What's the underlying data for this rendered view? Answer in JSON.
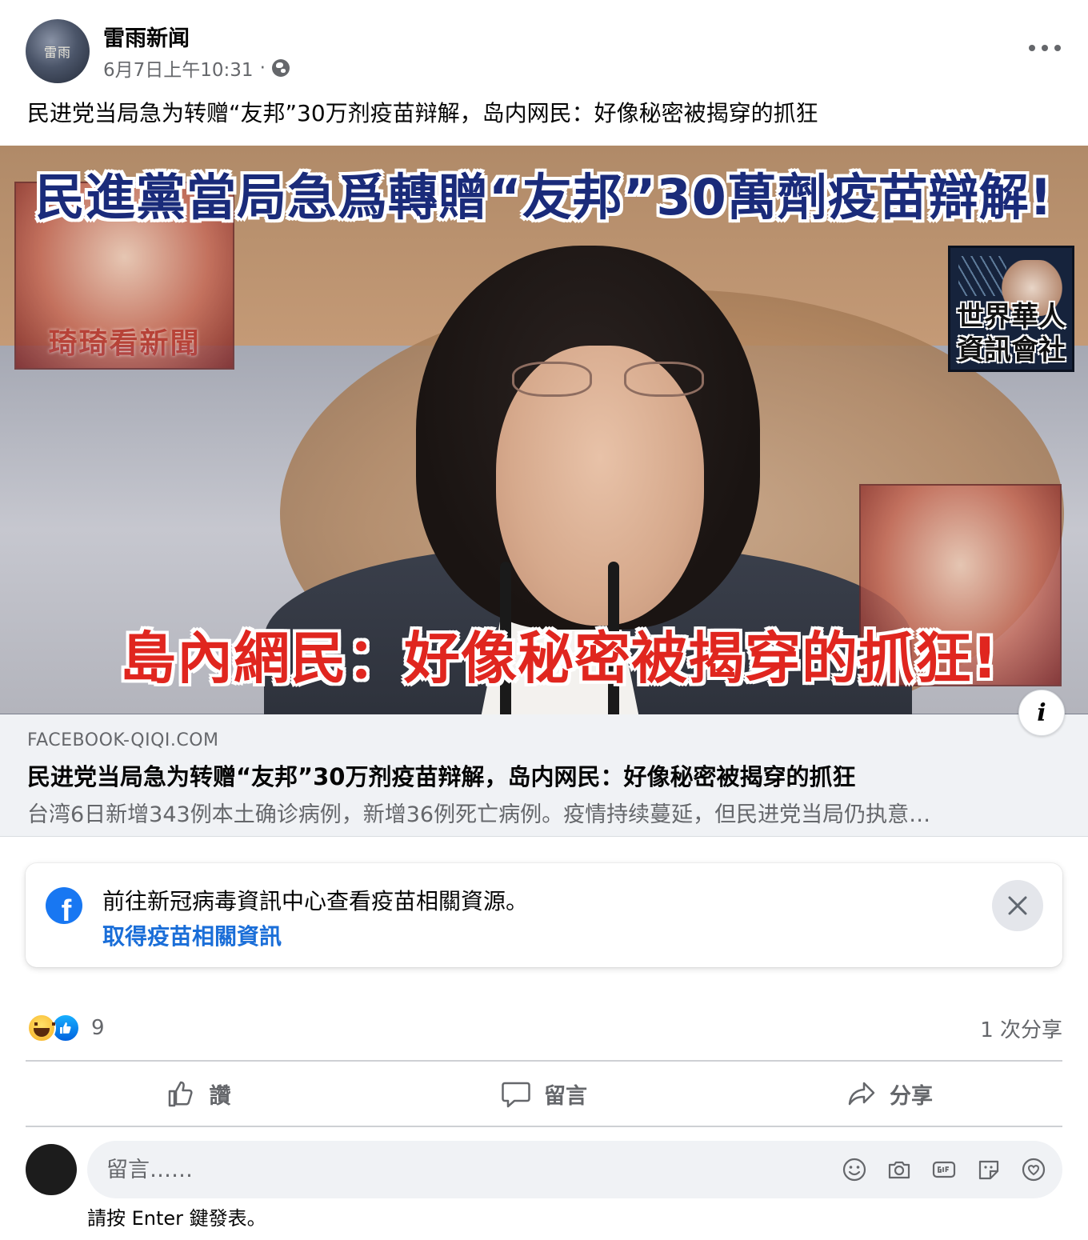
{
  "post": {
    "page_name": "雷雨新闻",
    "avatar_text": "雷雨",
    "timestamp": "6月7日上午10:31",
    "separator": "·",
    "privacy_icon": "globe-icon",
    "menu_icon": "more-horizontal-icon",
    "text": "民进党当局急为转赠“友邦”30万剂疫苗辩解，岛内网民：好像秘密被揭穿的抓狂"
  },
  "link_image": {
    "headline_top": "民進黨當局急爲轉贈“友邦”30萬劑疫苗辯解!",
    "headline_bottom": "島內網民：好像秘密被揭穿的抓狂!",
    "watermark_left": "琦琦看新聞",
    "watermark_right_line1": "世界華人",
    "watermark_right_line2": "資訊會社",
    "info_icon": "info-icon"
  },
  "link_preview": {
    "domain": "FACEBOOK-QIQI.COM",
    "title": "民进党当局急为转赠“友邦”30万剂疫苗辩解，岛内网民：好像秘密被揭穿的抓狂",
    "description": "台湾6日新增343例本土确诊病例，新增36例死亡病例。疫情持续蔓延，但民进党当局仍执意…"
  },
  "covid_notice": {
    "icon": "facebook-logo-icon",
    "text": "前往新冠病毒資訊中心查看疫苗相關資源。",
    "link_label": "取得疫苗相關資訊",
    "close_icon": "close-icon"
  },
  "engagement": {
    "reactions": [
      "haha",
      "like"
    ],
    "reaction_count": "9",
    "shares": "1 次分享"
  },
  "actions": {
    "like_label": "讚",
    "comment_label": "留言",
    "share_label": "分享"
  },
  "composer": {
    "placeholder": "留言……",
    "hint": "請按 Enter 鍵發表。",
    "icons": [
      "emoji-icon",
      "camera-icon",
      "gif-icon",
      "sticker-icon",
      "avatar-sticker-icon"
    ]
  },
  "colors": {
    "link_blue": "#1a6ed8",
    "facebook_blue": "#1877f2",
    "secondary_text": "#65676b",
    "headline_blue": "#1a2b7a",
    "headline_red": "#e0261f"
  }
}
